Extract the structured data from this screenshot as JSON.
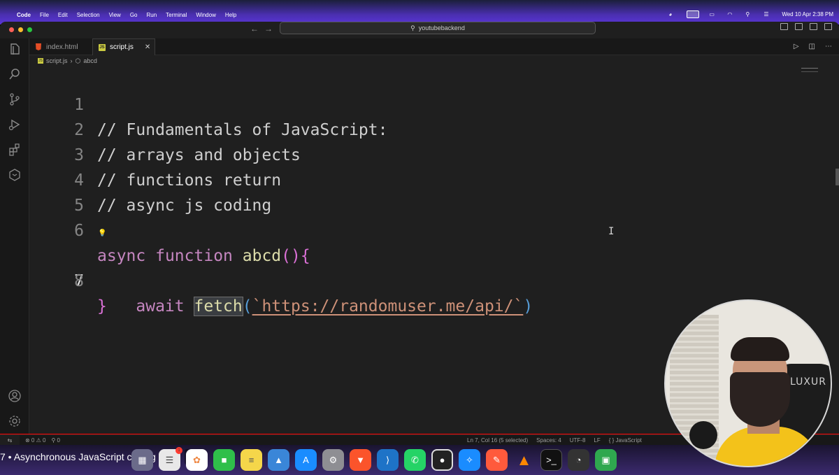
{
  "menubar": {
    "app": "Code",
    "items": [
      "File",
      "Edit",
      "Selection",
      "View",
      "Go",
      "Run",
      "Terminal",
      "Window",
      "Help"
    ],
    "clock": "Wed 10 Apr  2:38 PM"
  },
  "titlebar": {
    "search": "youtubebackend"
  },
  "tabs": [
    {
      "label": "index.html",
      "icon": "html-file-icon",
      "active": false
    },
    {
      "label": "script.js",
      "icon": "js-file-icon",
      "active": true
    }
  ],
  "breadcrumb": {
    "file": "script.js",
    "symbol": "abcd"
  },
  "editor": {
    "lines": [
      {
        "num": "1",
        "text": "// Fundamentals of JavaScript:"
      },
      {
        "num": "2",
        "text": "// arrays and objects"
      },
      {
        "num": "3",
        "text": "// functions return"
      },
      {
        "num": "4",
        "text": "// async js coding"
      },
      {
        "num": "5",
        "text": ""
      },
      {
        "num": "6",
        "kw1": "async",
        "kw2": "function",
        "fn": "abcd",
        "paren": "()",
        "brace": "{"
      },
      {
        "num": "7",
        "kw": "await",
        "fn": "fetch",
        "open": "(",
        "str": "`https://randomuser.me/api/`",
        "close": ")"
      },
      {
        "num": "8",
        "brace": "}"
      }
    ],
    "current_line": 7
  },
  "statusbar": {
    "problems": "⊗ 0 ⚠ 0",
    "ports": "⚲ 0",
    "position": "Ln 7, Col 16 (5 selected)",
    "spaces": "Spaces: 4",
    "encoding": "UTF-8",
    "eol": "LF",
    "language": "{ } JavaScript"
  },
  "overlay": {
    "chapter": "7  •  Asynchronous JavaScript coding",
    "chair_brand": "LUXUR"
  },
  "colors": {
    "menubar": "#4a2fb0",
    "editor_bg": "#1f1f1f",
    "keyword": "#c586c0",
    "function": "#dcdcaa",
    "string": "#ce9178",
    "progress_bar": "#ff0000"
  }
}
